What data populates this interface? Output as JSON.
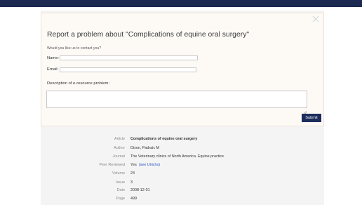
{
  "modal": {
    "title": "Report a problem about \"Complications of equine oral surgery\"",
    "contact_prompt": "Would you like us to contact you?",
    "name_label": "Name:",
    "email_label": "Email:",
    "description_label": "Description of e-resource problem:",
    "submit_label": "Submit"
  },
  "details": {
    "article": {
      "label": "Article",
      "value": "Complications of equine oral surgery"
    },
    "author": {
      "label": "Author",
      "value": "Dixon, Padraic M"
    },
    "journal": {
      "label": "Journal",
      "value": "The Veterinary clinics of North America. Equine practice"
    },
    "peer_reviewed": {
      "label": "Peer Reviewed",
      "value": "Yes",
      "link": "(see Ulrichs)"
    },
    "volume": {
      "label": "Volume",
      "value": "24"
    },
    "issue": {
      "label": "Issue",
      "value": "3"
    },
    "date": {
      "label": "Date",
      "value": "2008-12-01"
    },
    "page": {
      "label": "Page",
      "value": "499"
    }
  }
}
